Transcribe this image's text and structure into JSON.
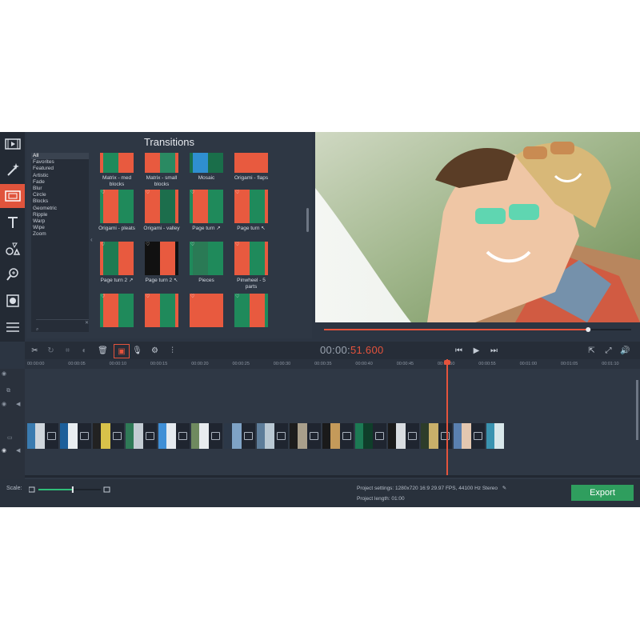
{
  "panel": {
    "title": "Transitions"
  },
  "categories": [
    "All",
    "Favorites",
    "Featured",
    "Artistic",
    "Fade",
    "Blur",
    "Circle",
    "Blocks",
    "Geometric",
    "Ripple",
    "Warp",
    "Wipe",
    "Zoom"
  ],
  "tiles": [
    {
      "label": "Matrix - med blocks",
      "heart": false,
      "colors": [
        "#e85a3f",
        "#1f8a5b"
      ]
    },
    {
      "label": "Matrix - small blocks",
      "heart": false,
      "colors": [
        "#e85a3f",
        "#2a8a62"
      ]
    },
    {
      "label": "Mosaic",
      "heart": false,
      "colors": [
        "#1a6e4a",
        "#2f8fd0"
      ]
    },
    {
      "label": "Origami - flaps",
      "heart": false,
      "colors": [
        "#e85a3f",
        "#e85a3f"
      ]
    },
    {
      "label": "Origami - pleats",
      "heart": true,
      "colors": [
        "#1f8a5b",
        "#e85a3f"
      ]
    },
    {
      "label": "Origami - valley",
      "heart": true,
      "colors": [
        "#e85a3f",
        "#1c6e4c"
      ]
    },
    {
      "label": "Page turn ↗",
      "heart": true,
      "colors": [
        "#1f8a5b",
        "#e85a3f"
      ]
    },
    {
      "label": "Page turn ↖",
      "heart": true,
      "colors": [
        "#e85a3f",
        "#1f8a5b"
      ]
    },
    {
      "label": "Page turn 2 ↗",
      "heart": true,
      "colors": [
        "#e85a3f",
        "#1e7b52"
      ]
    },
    {
      "label": "Page turn 2 ↖",
      "heart": true,
      "colors": [
        "#111111",
        "#e85a3f"
      ]
    },
    {
      "label": "Pieces",
      "heart": true,
      "colors": [
        "#1f8a5b",
        "#2a7a55"
      ]
    },
    {
      "label": "Pinwheel - 5 parts",
      "heart": true,
      "colors": [
        "#e85a3f",
        "#1f8a5b"
      ]
    },
    {
      "label": "",
      "heart": true,
      "colors": [
        "#1f8a5b",
        "#e85a3f"
      ]
    },
    {
      "label": "",
      "heart": true,
      "colors": [
        "#e85a3f",
        "#1f8a5b"
      ]
    },
    {
      "label": "",
      "heart": true,
      "colors": [
        "#e85a3f",
        "#e85a3f"
      ]
    },
    {
      "label": "",
      "heart": true,
      "colors": [
        "#1f8a5b",
        "#e85a3f"
      ]
    }
  ],
  "player": {
    "timecode_dim": "00:00:",
    "timecode_hi": "51.600",
    "progress": 0.86
  },
  "ruler": [
    "00:00:00",
    "00:00:05",
    "00:00:10",
    "00:00:15",
    "00:00:20",
    "00:00:25",
    "00:00:30",
    "00:00:35",
    "00:00:40",
    "00:00:45",
    "00:00:50",
    "00:00:55",
    "00:01:00",
    "00:01:05",
    "00:01:10"
  ],
  "clips": [
    {
      "colors": [
        "#3a7bb0",
        "#cfd6dc"
      ]
    },
    {
      "colors": [
        "#1d5f9a",
        "#e9eef2"
      ]
    },
    {
      "colors": [
        "#222222",
        "#d8c24a"
      ]
    },
    {
      "colors": [
        "#2f7a57",
        "#c3ccd3"
      ]
    },
    {
      "colors": [
        "#3f8fd6",
        "#e5eaef"
      ]
    },
    {
      "colors": [
        "#6f8a5f",
        "#e8ecef"
      ]
    },
    {
      "colors": [
        "#2c3848",
        "#7fa3c6"
      ]
    },
    {
      "colors": [
        "#5d7d9a",
        "#b9c8d3"
      ]
    },
    {
      "colors": [
        "#1d1d1d",
        "#a99f8b"
      ]
    },
    {
      "colors": [
        "#1a1a1a",
        "#c49a5a"
      ]
    },
    {
      "colors": [
        "#1c7a54",
        "#0f3e2a"
      ]
    },
    {
      "colors": [
        "#1a1a1a",
        "#d9dde1"
      ]
    },
    {
      "colors": [
        "#2d3c2a",
        "#c9b06a"
      ]
    },
    {
      "colors": [
        "#5a80b0",
        "#e3c7b0"
      ]
    },
    {
      "colors": [
        "#3a93b0",
        "#d8e7ea"
      ]
    }
  ],
  "footer": {
    "scale_label": "Scale:",
    "scale_value": 0.55,
    "settings": "Project settings:  1280x720 16:9 29.97 FPS, 44100 Hz Stereo",
    "length": "Project length:     01:00",
    "export": "Export"
  }
}
